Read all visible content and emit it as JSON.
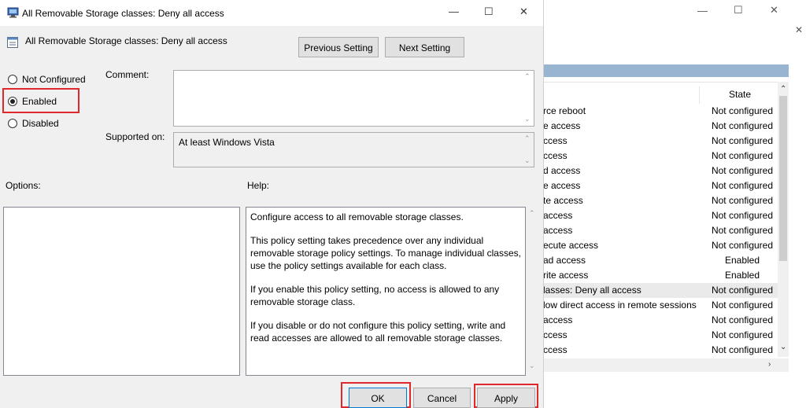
{
  "dialog": {
    "title": "All Removable Storage classes: Deny all access",
    "setting_name": "All Removable Storage classes: Deny all access",
    "window_controls": {
      "minimize": "—",
      "maximize": "☐",
      "close": "✕"
    },
    "prev_button": "Previous Setting",
    "next_button": "Next Setting",
    "radios": [
      {
        "label": "Not Configured",
        "selected": false
      },
      {
        "label": "Enabled",
        "selected": true
      },
      {
        "label": "Disabled",
        "selected": false
      }
    ],
    "comment_label": "Comment:",
    "comment_value": "",
    "supported_label": "Supported on:",
    "supported_value": "At least Windows Vista",
    "options_label": "Options:",
    "help_label": "Help:",
    "help_paragraphs": [
      "Configure access to all removable storage classes.",
      "This policy setting takes precedence over any individual removable storage policy settings. To manage individual classes, use the policy settings available for each class.",
      "If you enable this policy setting, no access is allowed to any removable storage class.",
      "If you disable or do not configure this policy setting, write and read accesses are allowed to all removable storage classes."
    ],
    "ok_button": "OK",
    "cancel_button": "Cancel",
    "apply_button": "Apply",
    "highlight_color": "#e0272b"
  },
  "background_window": {
    "controls": {
      "minimize": "—",
      "maximize": "☐",
      "close": "✕"
    },
    "secondary_close": "✕",
    "state_header": "State",
    "rows": [
      {
        "name": "rce reboot",
        "state": "Not configured",
        "selected": false
      },
      {
        "name": "e access",
        "state": "Not configured",
        "selected": false
      },
      {
        "name": "ccess",
        "state": "Not configured",
        "selected": false
      },
      {
        "name": "ccess",
        "state": "Not configured",
        "selected": false
      },
      {
        "name": "d access",
        "state": "Not configured",
        "selected": false
      },
      {
        "name": "e access",
        "state": "Not configured",
        "selected": false
      },
      {
        "name": "te access",
        "state": "Not configured",
        "selected": false
      },
      {
        "name": "access",
        "state": "Not configured",
        "selected": false
      },
      {
        "name": "access",
        "state": "Not configured",
        "selected": false
      },
      {
        "name": "ecute access",
        "state": "Not configured",
        "selected": false
      },
      {
        "name": "ad access",
        "state": "Enabled",
        "selected": false
      },
      {
        "name": "rite access",
        "state": "Enabled",
        "selected": false
      },
      {
        "name": "lasses: Deny all access",
        "state": "Not configured",
        "selected": true
      },
      {
        "name": "low direct access in remote sessions",
        "state": "Not configured",
        "selected": false
      },
      {
        "name": "access",
        "state": "Not configured",
        "selected": false
      },
      {
        "name": "ccess",
        "state": "Not configured",
        "selected": false
      },
      {
        "name": "ccess",
        "state": "Not configured",
        "selected": false
      }
    ]
  }
}
